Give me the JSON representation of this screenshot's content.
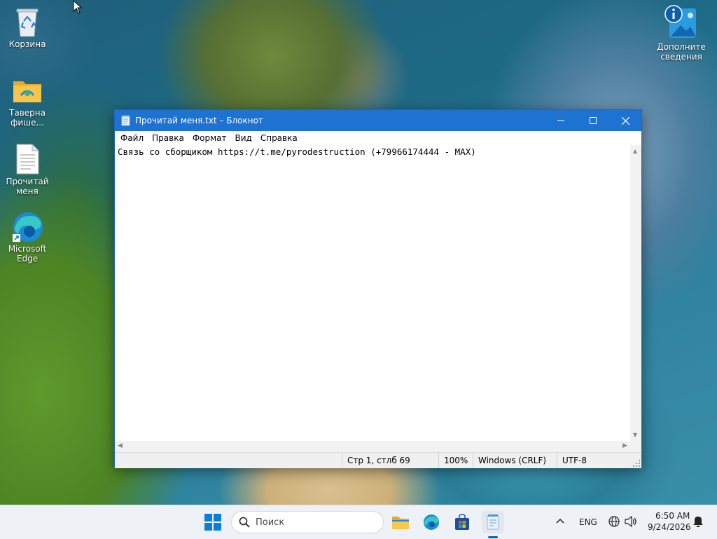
{
  "desktop": {
    "icons": [
      {
        "label": "Корзина",
        "icon": "recycle-bin-icon"
      },
      {
        "label": "Таверна фише...",
        "icon": "folder-icon"
      },
      {
        "label": "Прочитай меня",
        "icon": "text-file-icon"
      },
      {
        "label": "Microsoft Edge",
        "icon": "edge-icon"
      },
      {
        "label": "Дополните сведения о...",
        "icon": "info-photo-icon"
      }
    ]
  },
  "notepad": {
    "title": "Прочитай меня.txt – Блокнот",
    "menu": [
      "Файл",
      "Правка",
      "Формат",
      "Вид",
      "Справка"
    ],
    "content": "Связь со сборщиком https://t.me/pyrodestruction (+79966174444 - MAX)",
    "status": {
      "position": "Стр 1, стлб 69",
      "zoom": "100%",
      "line_endings": "Windows (CRLF)",
      "encoding": "UTF-8"
    }
  },
  "taskbar": {
    "search_placeholder": "Поиск",
    "apps": [
      "start-icon",
      "file-explorer-icon",
      "edge-icon",
      "store-icon",
      "notepad-icon"
    ],
    "language": "ENG",
    "time": "6:50 AM",
    "date": "9/24/2026"
  },
  "colors": {
    "titlebar": "#1e73d2",
    "accent": "#0067c0",
    "taskbar_bg": "#eef1f5"
  }
}
